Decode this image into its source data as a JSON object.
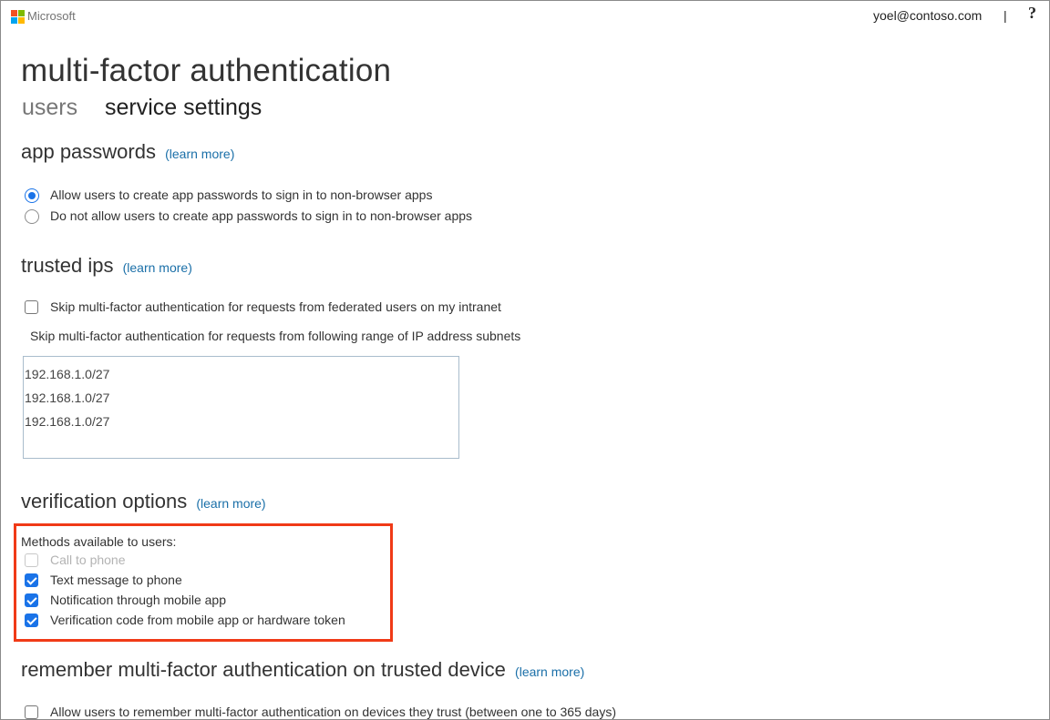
{
  "header": {
    "brand": "Microsoft",
    "user_email": "yoel@contoso.com",
    "separator": "|",
    "help": "?"
  },
  "page": {
    "title": "multi-factor authentication",
    "tabs": [
      {
        "label": "users",
        "active": false
      },
      {
        "label": "service settings",
        "active": true
      }
    ]
  },
  "app_passwords": {
    "heading": "app passwords",
    "learn_more": "(learn more)",
    "options": [
      {
        "label": "Allow users to create app passwords to sign in to non-browser apps",
        "selected": true
      },
      {
        "label": "Do not allow users to create app passwords to sign in to non-browser apps",
        "selected": false
      }
    ]
  },
  "trusted_ips": {
    "heading": "trusted ips",
    "learn_more": "(learn more)",
    "federated_checkbox": {
      "label": "Skip multi-factor authentication for requests from federated users on my intranet",
      "checked": false
    },
    "subnet_label": "Skip multi-factor authentication for requests from following range of IP address subnets",
    "subnets": [
      "192.168.1.0/27",
      "192.168.1.0/27",
      "192.168.1.0/27"
    ]
  },
  "verification_options": {
    "heading": "verification options",
    "learn_more": "(learn more)",
    "methods_label": "Methods available to users:",
    "methods": [
      {
        "label": "Call to phone",
        "checked": false,
        "disabled": true
      },
      {
        "label": "Text message to phone",
        "checked": true,
        "disabled": false
      },
      {
        "label": "Notification through mobile app",
        "checked": true,
        "disabled": false
      },
      {
        "label": "Verification code from mobile app or hardware token",
        "checked": true,
        "disabled": false
      }
    ],
    "highlight_color": "#f03a17"
  },
  "remember_mfa": {
    "heading": "remember multi-factor authentication on trusted device",
    "learn_more": "(learn more)",
    "checkbox": {
      "label": "Allow users to remember multi-factor authentication on devices they trust (between one to 365 days)",
      "checked": false
    }
  },
  "colors": {
    "accent": "#1a73e8",
    "link": "#1a6fa8"
  }
}
